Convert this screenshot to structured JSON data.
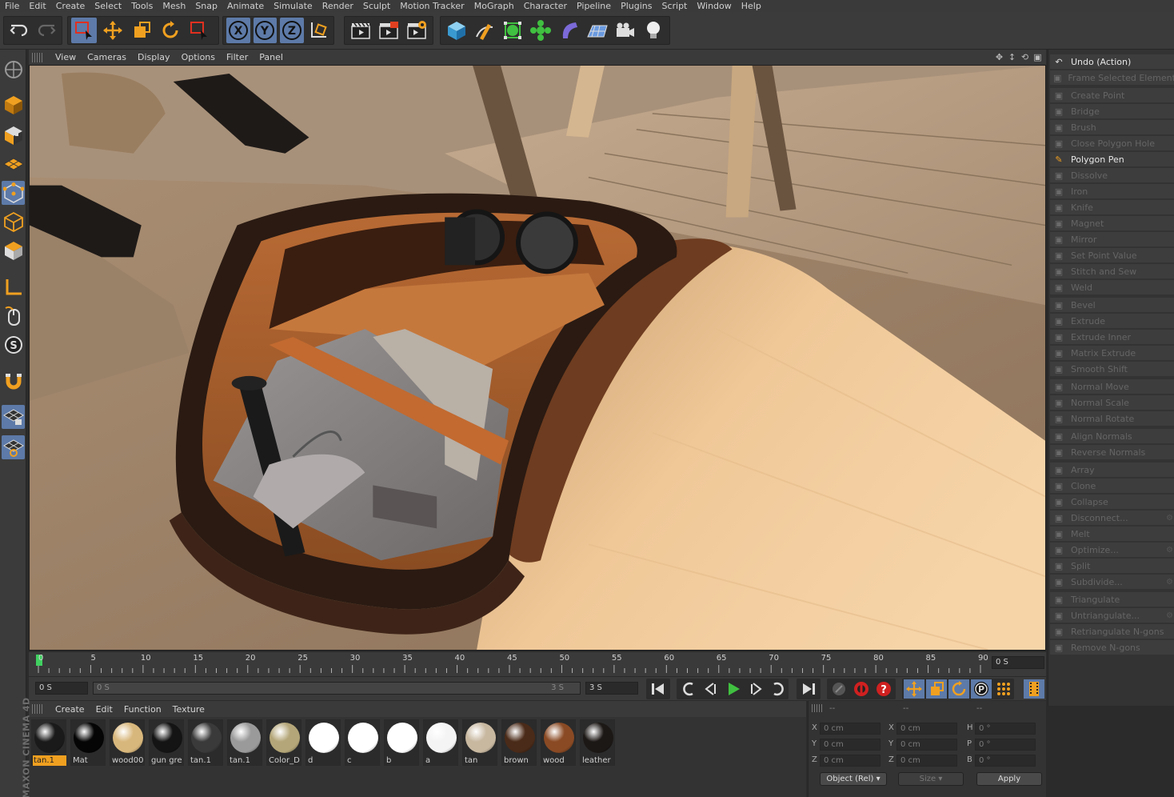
{
  "menu": [
    "File",
    "Edit",
    "Create",
    "Select",
    "Tools",
    "Mesh",
    "Snap",
    "Animate",
    "Simulate",
    "Render",
    "Sculpt",
    "Motion Tracker",
    "MoGraph",
    "Character",
    "Pipeline",
    "Plugins",
    "Script",
    "Window",
    "Help"
  ],
  "toolbar": {
    "axis_labels": [
      "X",
      "Y",
      "Z"
    ]
  },
  "viewport": {
    "menu": [
      "View",
      "Cameras",
      "Display",
      "Options",
      "Filter",
      "Panel"
    ]
  },
  "command_panel": {
    "items": [
      {
        "label": "Undo (Action)",
        "state": "enabled",
        "icon": "undo-icon"
      },
      {
        "label": "Frame Selected Elements",
        "state": "disabled",
        "icon": "frame-icon"
      },
      {
        "label": "Create Point",
        "state": "disabled",
        "icon": "point-icon"
      },
      {
        "label": "Bridge",
        "state": "disabled",
        "icon": "bridge-icon"
      },
      {
        "label": "Brush",
        "state": "disabled",
        "icon": "brush-icon"
      },
      {
        "label": "Close Polygon Hole",
        "state": "disabled",
        "icon": "hole-icon"
      },
      {
        "label": "Polygon Pen",
        "state": "active",
        "icon": "pen-icon"
      },
      {
        "label": "Dissolve",
        "state": "disabled",
        "icon": "dissolve-icon"
      },
      {
        "label": "Iron",
        "state": "disabled",
        "icon": "iron-icon"
      },
      {
        "label": "Knife",
        "state": "disabled",
        "icon": "knife-icon"
      },
      {
        "label": "Magnet",
        "state": "disabled",
        "icon": "magnet-icon"
      },
      {
        "label": "Mirror",
        "state": "disabled",
        "icon": "mirror-icon"
      },
      {
        "label": "Set Point Value",
        "state": "disabled",
        "icon": "point-value-icon"
      },
      {
        "label": "Stitch and Sew",
        "state": "disabled",
        "icon": "stitch-icon"
      },
      {
        "label": "Weld",
        "state": "disabled",
        "icon": "weld-icon"
      },
      {
        "label": "Bevel",
        "state": "disabled",
        "icon": "bevel-icon"
      },
      {
        "label": "Extrude",
        "state": "disabled",
        "icon": "extrude-icon"
      },
      {
        "label": "Extrude Inner",
        "state": "disabled",
        "icon": "extrude-inner-icon"
      },
      {
        "label": "Matrix Extrude",
        "state": "disabled",
        "icon": "matrix-extrude-icon"
      },
      {
        "label": "Smooth Shift",
        "state": "disabled",
        "icon": "smooth-shift-icon"
      },
      {
        "label": "Normal Move",
        "state": "disabled",
        "icon": "normal-move-icon"
      },
      {
        "label": "Normal Scale",
        "state": "disabled",
        "icon": "normal-scale-icon"
      },
      {
        "label": "Normal Rotate",
        "state": "disabled",
        "icon": "normal-rotate-icon"
      },
      {
        "label": "Align Normals",
        "state": "disabled",
        "icon": "align-normals-icon"
      },
      {
        "label": "Reverse Normals",
        "state": "disabled",
        "icon": "reverse-normals-icon"
      },
      {
        "label": "Array",
        "state": "disabled",
        "icon": "array-icon"
      },
      {
        "label": "Clone",
        "state": "disabled",
        "icon": "clone-icon"
      },
      {
        "label": "Collapse",
        "state": "disabled",
        "icon": "collapse-icon"
      },
      {
        "label": "Disconnect...",
        "state": "disabled",
        "icon": "disconnect-icon",
        "more": true
      },
      {
        "label": "Melt",
        "state": "disabled",
        "icon": "melt-icon"
      },
      {
        "label": "Optimize...",
        "state": "disabled",
        "icon": "optimize-icon",
        "more": true
      },
      {
        "label": "Split",
        "state": "disabled",
        "icon": "split-icon"
      },
      {
        "label": "Subdivide...",
        "state": "disabled",
        "icon": "subdivide-icon",
        "more": true
      },
      {
        "label": "Triangulate",
        "state": "disabled",
        "icon": "triangulate-icon"
      },
      {
        "label": "Untriangulate...",
        "state": "disabled",
        "icon": "untriangulate-icon",
        "more": true
      },
      {
        "label": "Retriangulate N-gons",
        "state": "disabled",
        "icon": "retriangulate-icon"
      },
      {
        "label": "Remove N-gons",
        "state": "disabled",
        "icon": "remove-ngons-icon"
      }
    ]
  },
  "timeline": {
    "ticks": [
      "0",
      "5",
      "10",
      "15",
      "20",
      "25",
      "30",
      "35",
      "40",
      "45",
      "50",
      "55",
      "60",
      "65",
      "70",
      "75",
      "80",
      "85",
      "90"
    ],
    "end_field": "0 S",
    "current": "0 S",
    "range_start": "0 S",
    "range_end": "3 S",
    "max": "3 S"
  },
  "material_panel": {
    "menu": [
      "Create",
      "Edit",
      "Function",
      "Texture"
    ],
    "materials": [
      {
        "label": "tan.1",
        "color": "#1a1a1a",
        "selected": true
      },
      {
        "label": "Mat",
        "color": "#050505"
      },
      {
        "label": "wood00",
        "color": "#d8b77c"
      },
      {
        "label": "gun gre",
        "color": "#141414"
      },
      {
        "label": "tan.1",
        "color": "#3a3a3a"
      },
      {
        "label": "tan.1",
        "color": "#9a9a9a"
      },
      {
        "label": "Color_D",
        "color": "#b4a678"
      },
      {
        "label": "d",
        "color": "#ffffff"
      },
      {
        "label": "c",
        "color": "#ffffff"
      },
      {
        "label": "b",
        "color": "#ffffff"
      },
      {
        "label": "a",
        "color": "#f4f4f4"
      },
      {
        "label": "tan",
        "color": "#c8b8a0"
      },
      {
        "label": "brown",
        "color": "#4a2a18"
      },
      {
        "label": "wood",
        "color": "#8a4a24"
      },
      {
        "label": "leather",
        "color": "#1c1816"
      }
    ]
  },
  "coordinates": {
    "headers": [
      "--",
      "--",
      "--"
    ],
    "rows": [
      {
        "l1": "X",
        "v1": "0 cm",
        "l2": "X",
        "v2": "0 cm",
        "l3": "H",
        "v3": "0 °"
      },
      {
        "l1": "Y",
        "v1": "0 cm",
        "l2": "Y",
        "v2": "0 cm",
        "l3": "P",
        "v3": "0 °"
      },
      {
        "l1": "Z",
        "v1": "0 cm",
        "l2": "Z",
        "v2": "0 cm",
        "l3": "B",
        "v3": "0 °"
      }
    ],
    "mode": "Object (Rel)",
    "size_mode": "Size",
    "apply": "Apply"
  },
  "brand": "MAXON CINEMA 4D"
}
